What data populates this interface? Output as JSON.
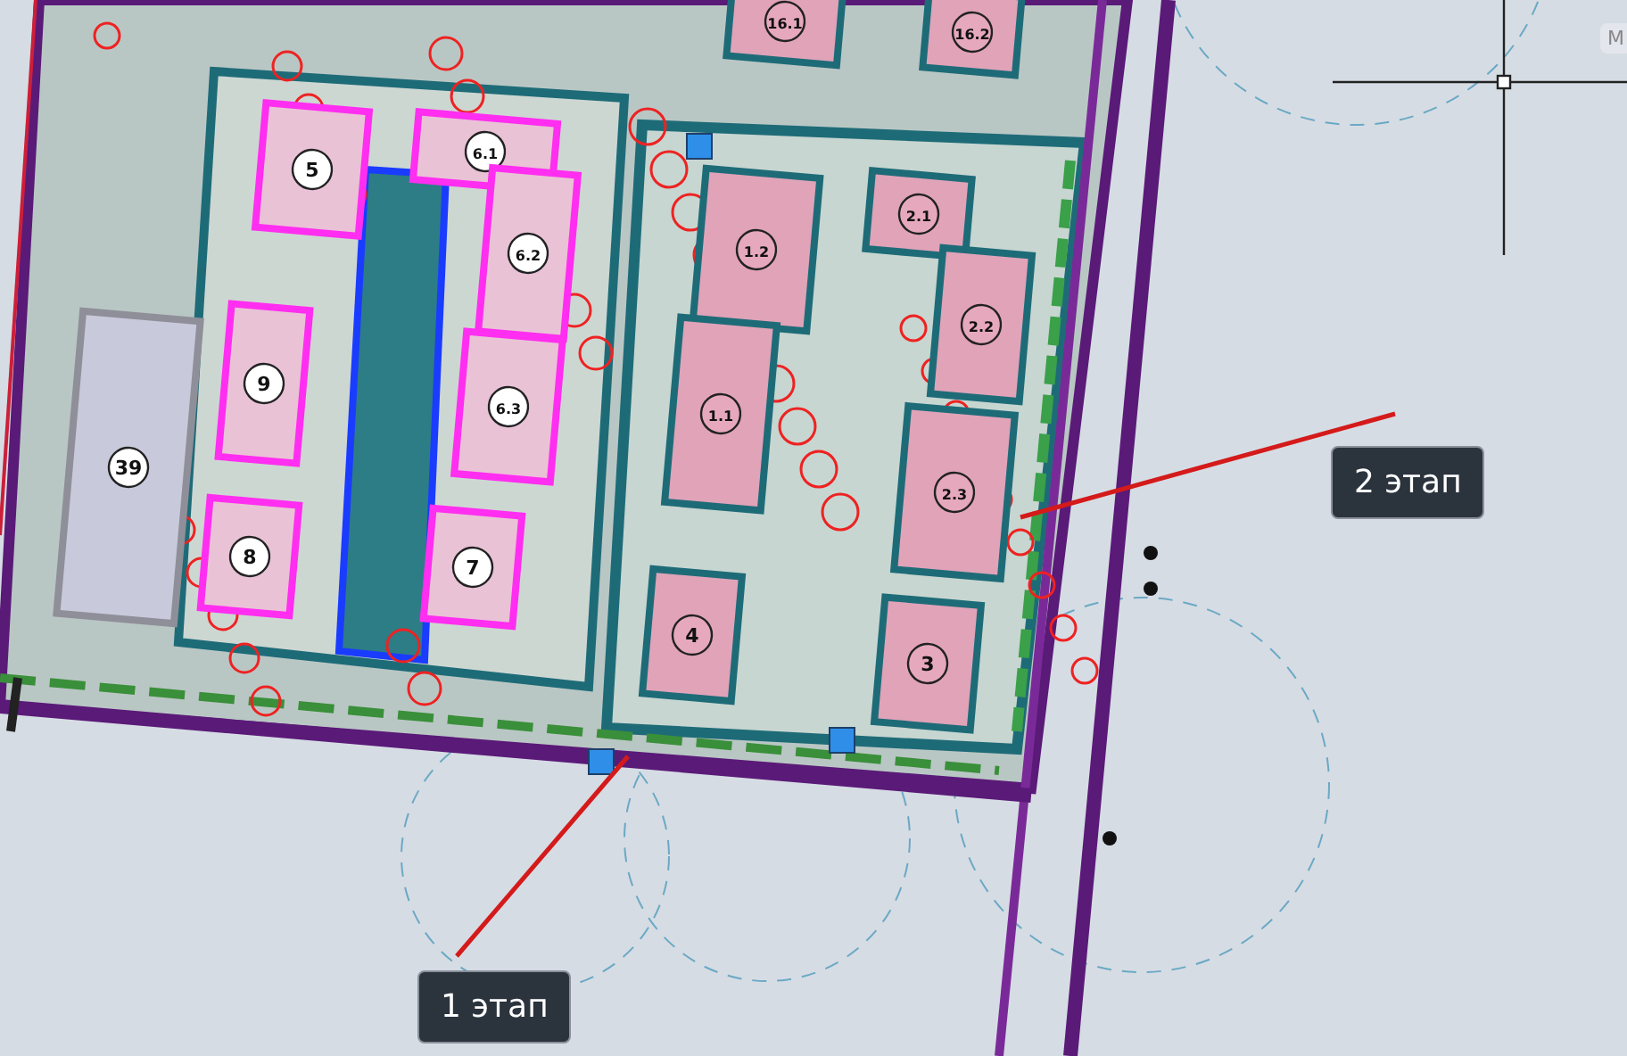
{
  "drawing": {
    "buildings": [
      {
        "label": "5"
      },
      {
        "label": "6.1"
      },
      {
        "label": "6.2"
      },
      {
        "label": "6.3"
      },
      {
        "label": "9"
      },
      {
        "label": "8"
      },
      {
        "label": "7"
      },
      {
        "label": "39"
      },
      {
        "label": "1.2"
      },
      {
        "label": "1.1"
      },
      {
        "label": "2.1"
      },
      {
        "label": "2.2"
      },
      {
        "label": "2.3"
      },
      {
        "label": "4"
      },
      {
        "label": "3"
      },
      {
        "label": "16.1"
      },
      {
        "label": "16.2"
      }
    ]
  },
  "callouts": [
    {
      "label": "2 этап"
    },
    {
      "label": "1 этап"
    }
  ],
  "tooltip": {
    "text": "M"
  }
}
